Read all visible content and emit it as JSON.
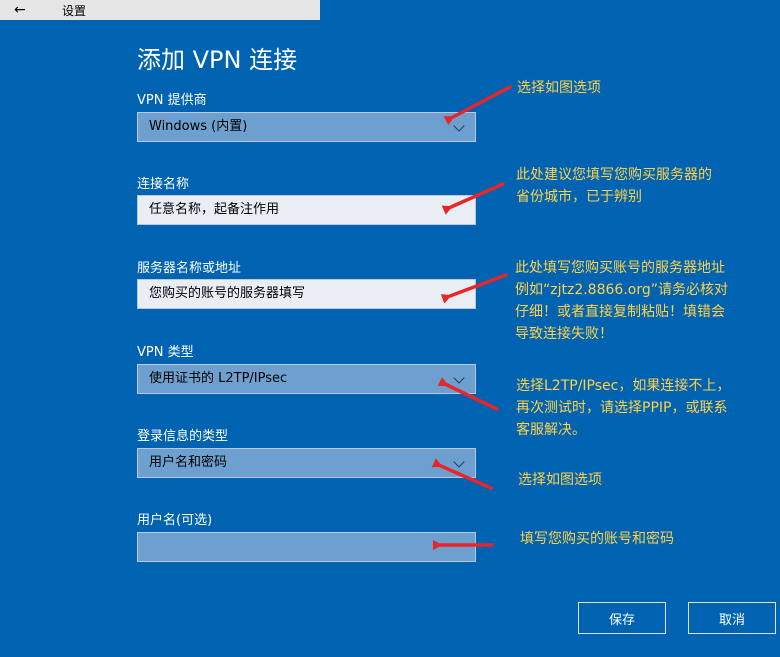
{
  "titlebar": {
    "back_glyph": "←",
    "title": "设置"
  },
  "dialog": {
    "title": "添加 VPN 连接",
    "fields": [
      {
        "label": "VPN 提供商",
        "value": "Windows (内置)",
        "kind": "select"
      },
      {
        "label": "连接名称",
        "value": "任意名称，起备注作用",
        "kind": "input"
      },
      {
        "label": "服务器名称或地址",
        "value": "您购买的账号的服务器填写",
        "kind": "input"
      },
      {
        "label": "VPN 类型",
        "value": "使用证书的 L2TP/IPsec",
        "kind": "select"
      },
      {
        "label": "登录信息的类型",
        "value": "用户名和密码",
        "kind": "select"
      },
      {
        "label": "用户名(可选)",
        "value": "",
        "kind": "input"
      }
    ],
    "save_label": "保存",
    "cancel_label": "取消"
  },
  "annotations": [
    {
      "lines": [
        "选择如图选项"
      ]
    },
    {
      "lines": [
        "此处建议您填写您购买服务器的",
        "省份城市，已于辨别"
      ]
    },
    {
      "lines": [
        "此处填写您购买账号的服务器地址",
        "例如“zjtz2.8866.org”请务必核对",
        "仔细！或者直接复制粘贴！填错会",
        "导致连接失败！"
      ]
    },
    {
      "lines": [
        "选择L2TP/IPsec，如果连接不上，",
        "再次测试时，请选择PPIP，或联系",
        "客服解决。"
      ]
    },
    {
      "lines": [
        "选择如图选项"
      ]
    },
    {
      "lines": [
        "填写您购买的账号和密码"
      ]
    }
  ],
  "colors": {
    "background": "#0063b1",
    "select_fill": "#6ea0cf",
    "input_fill": "#e9eef4",
    "annotation_text": "#ffd24a",
    "arrow": "#e8262a"
  },
  "icons": {
    "back": "back-arrow-icon",
    "dropdown": "chevron-down-icon"
  }
}
